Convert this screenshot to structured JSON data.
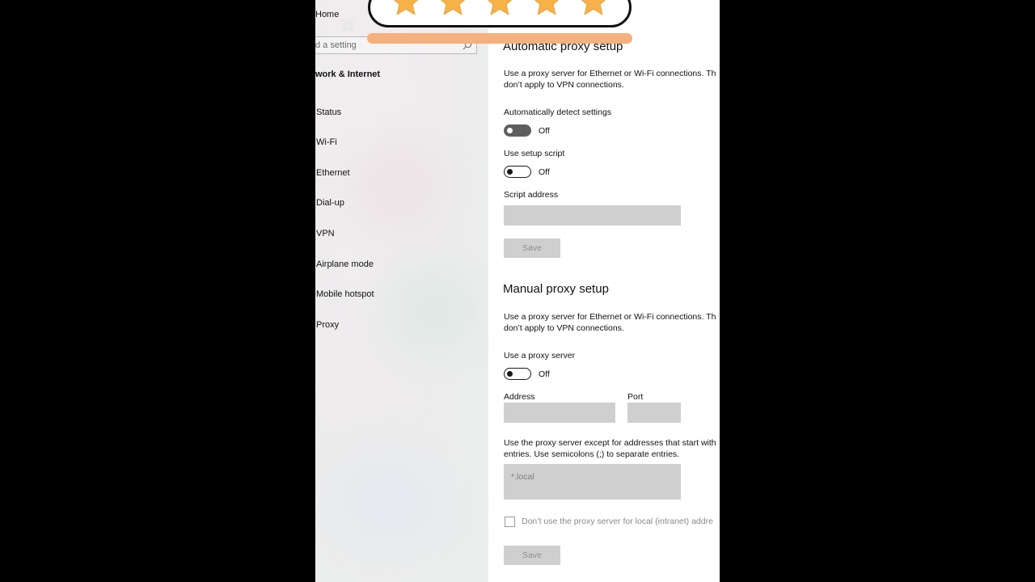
{
  "sidebar": {
    "home_label": "Home",
    "search_placeholder": "d a setting",
    "section_title": "work & Internet",
    "items": [
      {
        "label": "Status"
      },
      {
        "label": "Wi-Fi"
      },
      {
        "label": "Ethernet"
      },
      {
        "label": "Dial-up"
      },
      {
        "label": "VPN"
      },
      {
        "label": "Airplane mode"
      },
      {
        "label": "Mobile hotspot"
      },
      {
        "label": "Proxy"
      }
    ]
  },
  "automatic": {
    "title": "Automatic proxy setup",
    "desc_line1": "Use a proxy server for Ethernet or Wi-Fi connections. Th",
    "desc_line2": "don’t apply to VPN connections.",
    "detect_label": "Automatically detect settings",
    "detect_state": "Off",
    "script_label": "Use setup script",
    "script_state": "Off",
    "address_label": "Script address",
    "save_label": "Save"
  },
  "manual": {
    "title": "Manual proxy setup",
    "desc_line1": "Use a proxy server for Ethernet or Wi-Fi connections. Th",
    "desc_line2": "don’t apply to VPN connections.",
    "use_label": "Use a proxy server",
    "use_state": "Off",
    "address_label": "Address",
    "port_label": "Port",
    "except_line1": "Use the proxy server except for addresses that start with",
    "except_line2": "entries. Use semicolons (;) to separate entries.",
    "except_placeholder": "*.local",
    "local_checkbox_label": "Don’t use the proxy server for local (intranet) addre",
    "save_label": "Save"
  },
  "overlay": {
    "stars": 5,
    "star_color": "#f7b24a",
    "bar_color": "#f5b07c"
  }
}
